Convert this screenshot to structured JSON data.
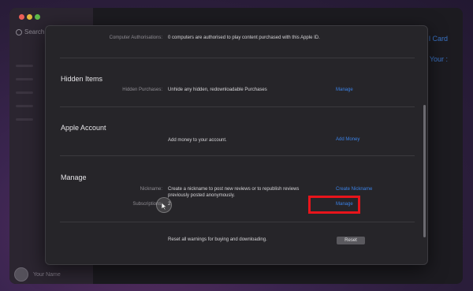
{
  "background_app": {
    "search_placeholder": "Search",
    "right_link_1": "l Card",
    "right_link_2": "Your :",
    "user_name": "Your Name"
  },
  "sheet": {
    "computer_auth": {
      "label": "Computer Authorisations:",
      "value": "0 computers are authorised to play content purchased with this Apple ID."
    },
    "hidden_items": {
      "heading": "Hidden Items",
      "label": "Hidden Purchases:",
      "value": "Unhide any hidden, redownloadable Purchases",
      "action": "Manage"
    },
    "apple_account": {
      "heading": "Apple Account",
      "value": "Add money to your account.",
      "action": "Add Money"
    },
    "manage": {
      "heading": "Manage",
      "nickname_label": "Nickname:",
      "nickname_value_line1": "Create a nickname to post new reviews or to republish reviews",
      "nickname_value_line2": "previously posted anonymously.",
      "nickname_action": "Create Nickname",
      "subscriptions_label": "Subscriptions:",
      "subscriptions_value": "2",
      "subscriptions_action": "Manage"
    },
    "warnings": {
      "value": "Reset all warnings for buying and downloading.",
      "action": "Reset"
    }
  },
  "colors": {
    "link": "#3b82e6",
    "highlight": "#e8141b"
  }
}
